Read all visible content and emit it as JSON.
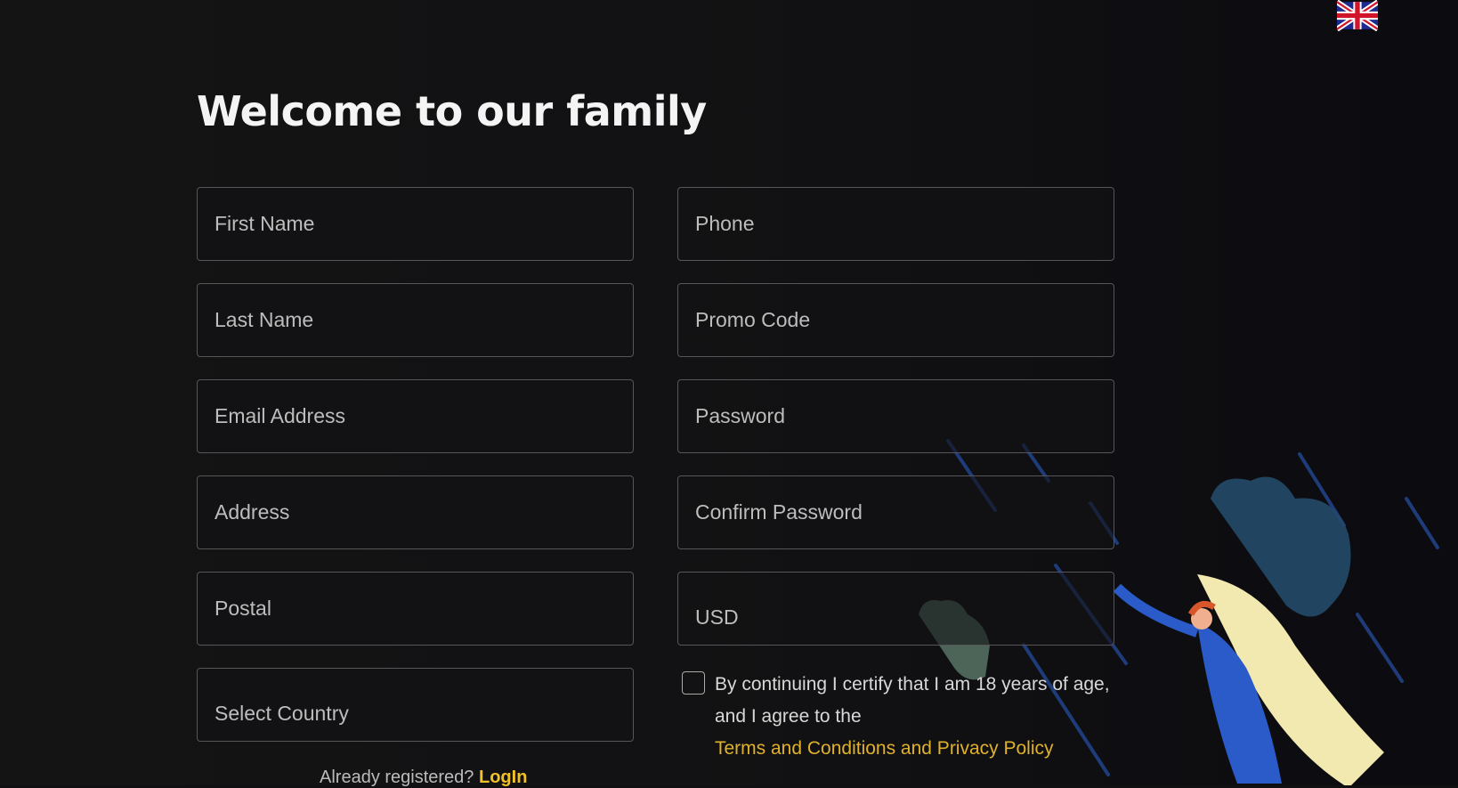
{
  "language": {
    "icon": "uk-flag-icon"
  },
  "title": "Welcome to our family",
  "form": {
    "first_name": "First Name",
    "last_name": "Last Name",
    "email": "Email Address",
    "address": "Address",
    "postal": "Postal",
    "country": "Select Country",
    "phone": "Phone",
    "promo": "Promo Code",
    "password": "Password",
    "confirm_password": "Confirm Password",
    "currency": "USD"
  },
  "agreement": {
    "text1": "By continuing I certify that I am 18 years of age,",
    "text2": "and I agree to the",
    "link": "Terms and Conditions and Privacy Policy",
    "checked": false
  },
  "footer": {
    "prompt": "Already registered?",
    "login": "LogIn"
  },
  "colors": {
    "accent": "#f2c028",
    "background": "#111113"
  }
}
